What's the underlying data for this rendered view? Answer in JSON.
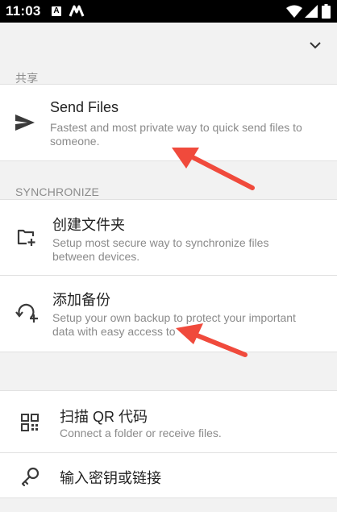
{
  "status_bar": {
    "time": "11:03",
    "notification_letter": "A"
  },
  "sections": {
    "share_header": "共享",
    "sync_header": "SYNCHRONIZE"
  },
  "send_files": {
    "title": "Send Files",
    "description": "Fastest and most private way to quick send files to someone."
  },
  "create_folder": {
    "title": "创建文件夹",
    "description": "Setup most secure way to synchronize files between devices."
  },
  "add_backup": {
    "title": "添加备份",
    "description": "Setup your own backup to protect your important data with easy access to"
  },
  "scan_qr": {
    "title": "扫描 QR 代码",
    "description": "Connect a folder or receive files."
  },
  "enter_key": {
    "title": "输入密钥或链接"
  },
  "colors": {
    "annotation_arrow": "#f04a3c",
    "icon": "#3a3a3a"
  }
}
